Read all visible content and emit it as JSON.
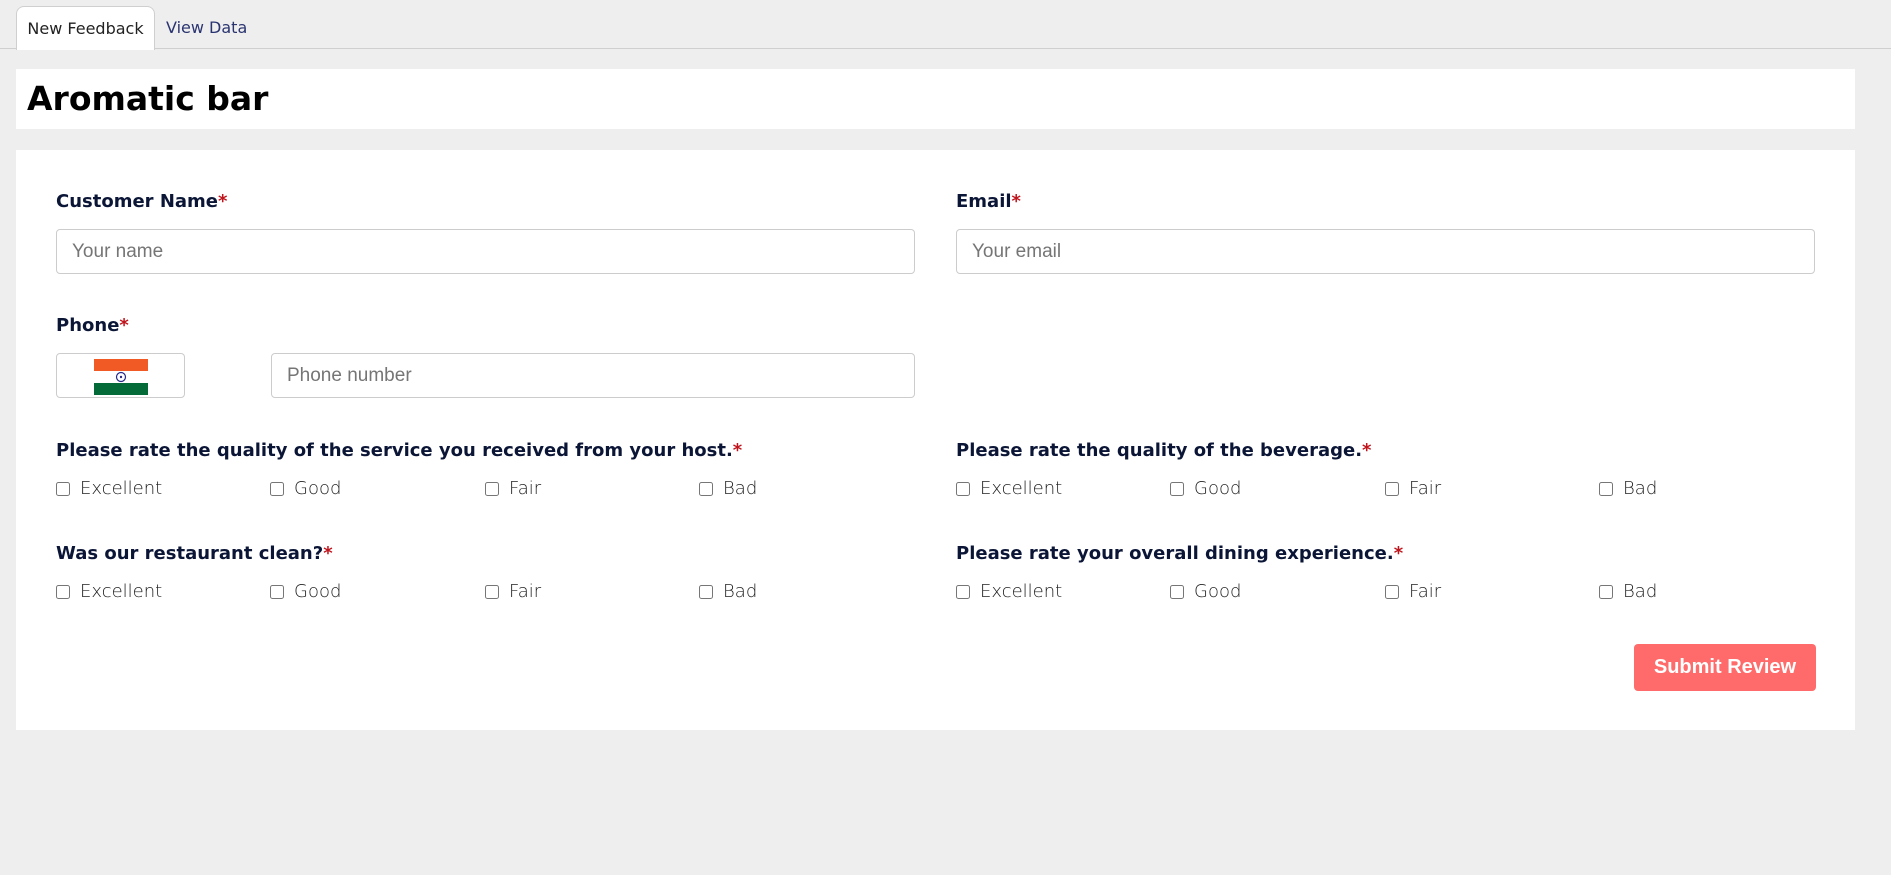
{
  "tabs": [
    {
      "label": "New Feedback",
      "active": true
    },
    {
      "label": "View Data",
      "active": false
    }
  ],
  "title": "Aromatic bar",
  "form": {
    "name": {
      "label": "Customer Name",
      "required": "*",
      "placeholder": "Your name"
    },
    "email": {
      "label": "Email",
      "required": "*",
      "placeholder": "Your email"
    },
    "phone": {
      "label": "Phone",
      "required": "*",
      "placeholder": "Phone number",
      "country_flag": "india-flag-icon"
    },
    "questions": [
      {
        "label": "Please rate the quality of the service you received from your host.",
        "required": "*"
      },
      {
        "label": "Please rate the quality of the beverage.",
        "required": "*"
      },
      {
        "label": "Was our restaurant clean?",
        "required": "*"
      },
      {
        "label": "Please rate your overall dining experience.",
        "required": "*"
      }
    ],
    "options": [
      "Excellent",
      "Good",
      "Fair",
      "Bad"
    ],
    "submit_label": "Submit Review"
  },
  "colors": {
    "accent": "#ff6b6b",
    "required": "#c0141c"
  }
}
